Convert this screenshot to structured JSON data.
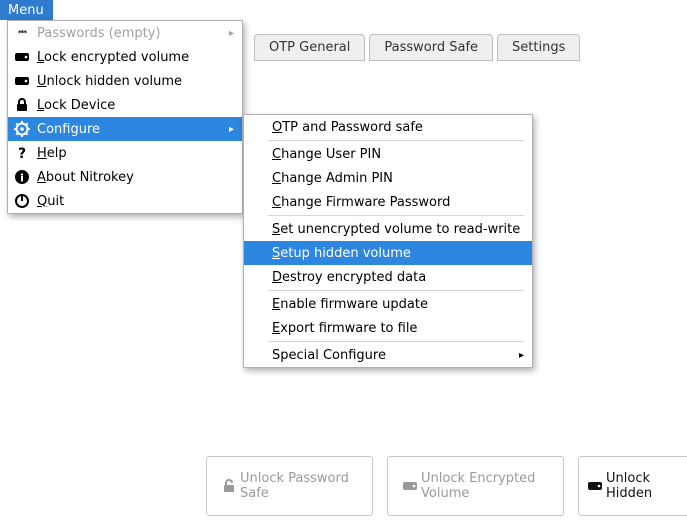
{
  "menu_button": "Menu",
  "tabs": {
    "t0": "",
    "t1": "OTP General",
    "t2": "Password Safe",
    "t3": "Settings"
  },
  "dropdown": {
    "passwords": "Passwords (empty)",
    "lock_encrypted": "Lock encrypted volume",
    "unlock_hidden": "Unlock hidden volume",
    "lock_device": "Lock Device",
    "configure": "Configure",
    "help": "Help",
    "about": "About Nitrokey",
    "quit": "Quit"
  },
  "submenu": {
    "otp_pwd": "OTP and Password safe",
    "chg_user_pin": "Change User PIN",
    "chg_admin_pin": "Change Admin PIN",
    "chg_fw_pwd": "Change Firmware Password",
    "set_unenc_rw": "Set unencrypted volume to read-write",
    "setup_hidden": "Setup hidden volume",
    "destroy_enc": "Destroy encrypted data",
    "enable_fw_upd": "Enable firmware update",
    "export_fw": "Export firmware to file",
    "special_conf": "Special Configure"
  },
  "actions": {
    "unlock_pwd_safe": "Unlock Password Safe",
    "unlock_enc_vol": "Unlock Encrypted Volume",
    "unlock_hidden": "Unlock Hidden "
  }
}
